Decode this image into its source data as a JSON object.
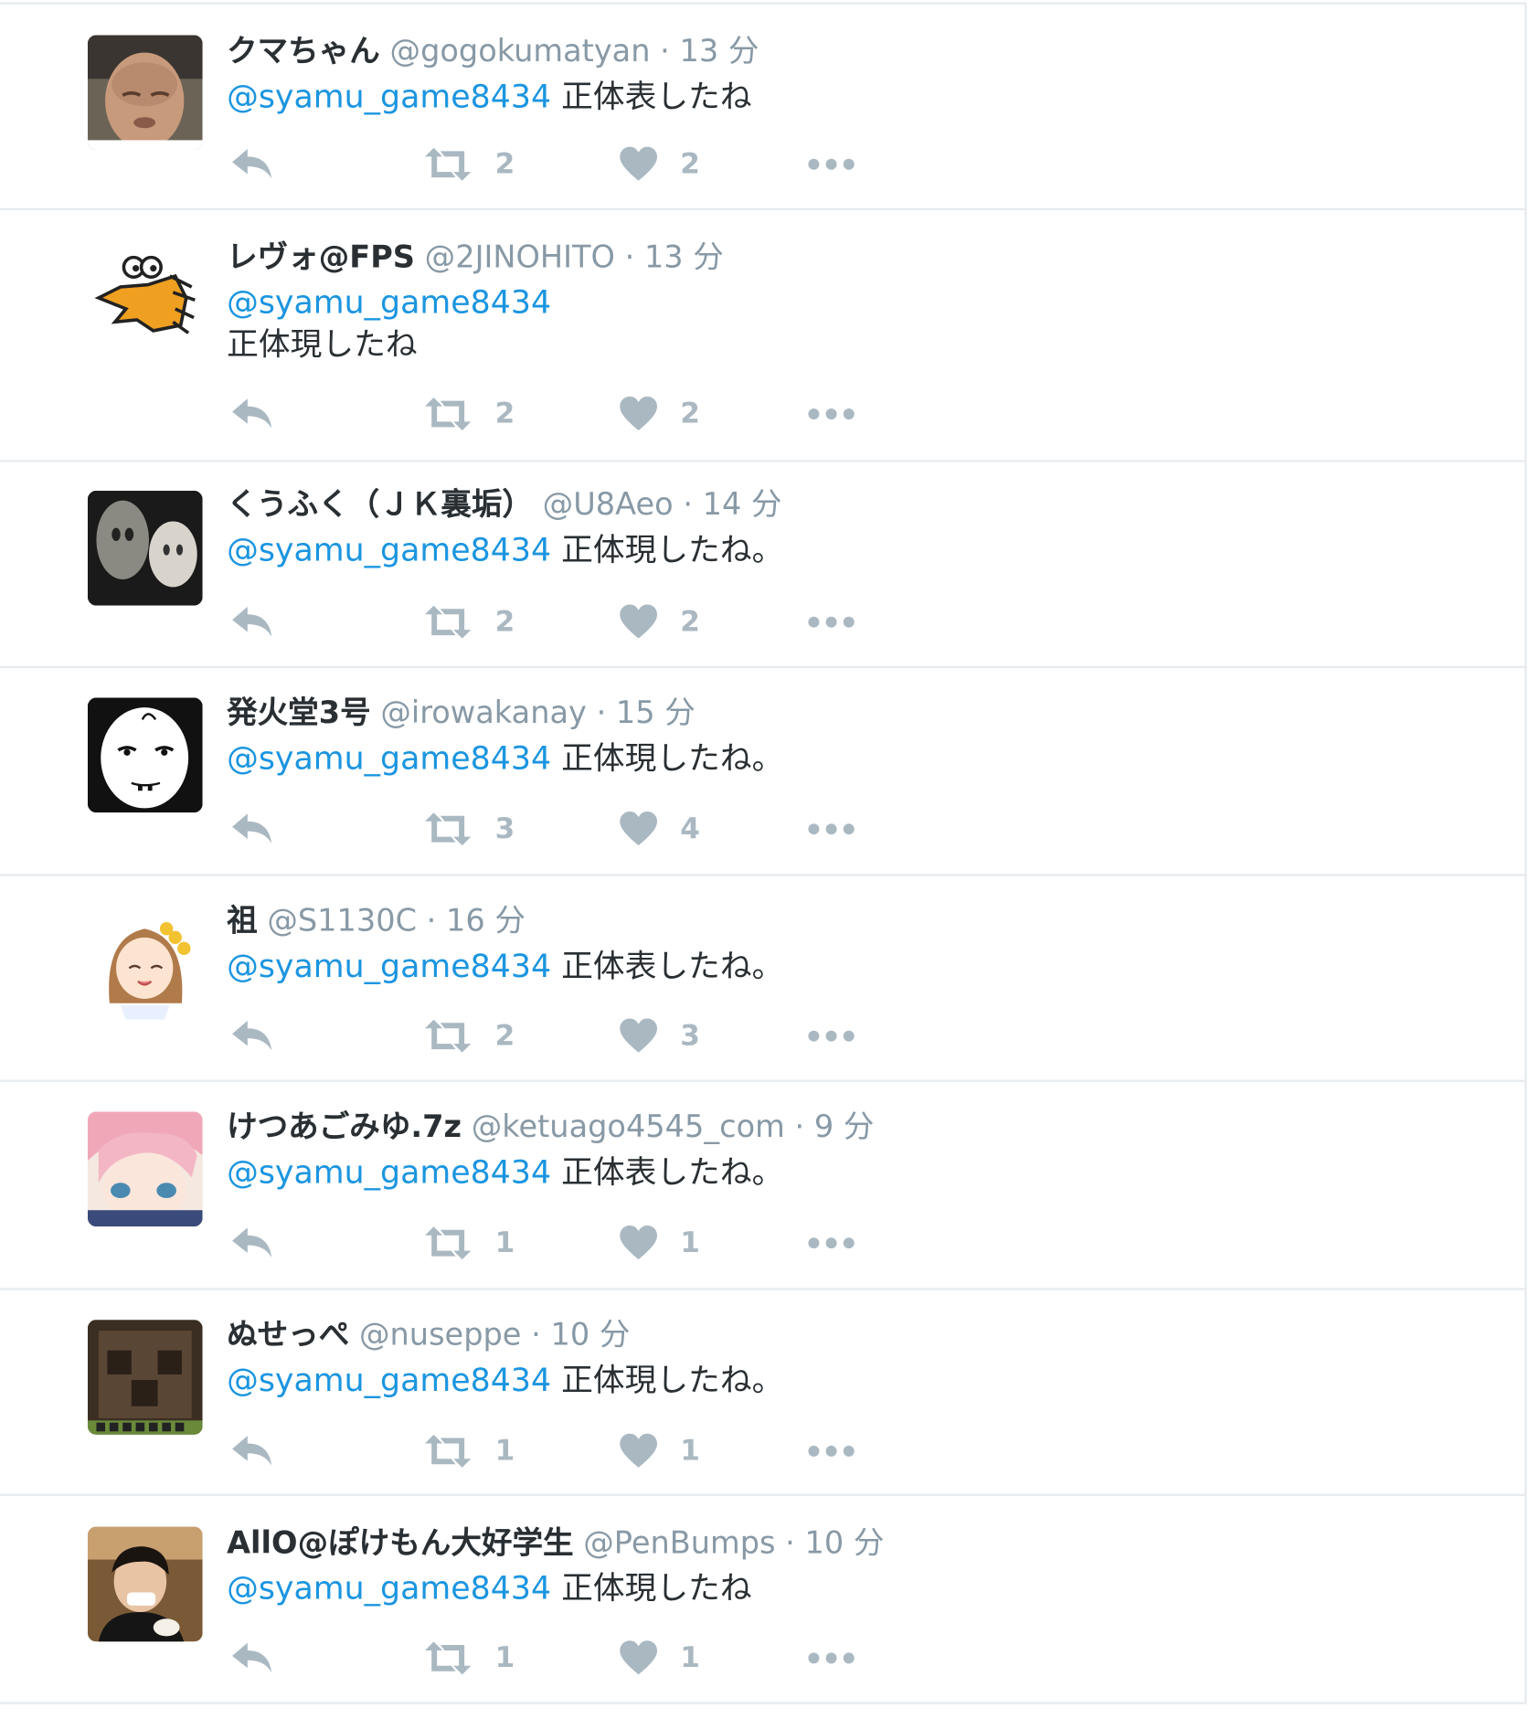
{
  "tweets": [
    {
      "name": "クマちゃん",
      "handle": "@gogokumatyan",
      "dot": "·",
      "time": "13 分",
      "mention": "@syamu_game8434",
      "text": " 正体表したね",
      "text2": "",
      "retweets": "2",
      "likes": "2",
      "avatar": "avatar-photo-man"
    },
    {
      "name": "レヴォ@FPS",
      "handle": "@2JINOHITO",
      "dot": "·",
      "time": "13 分",
      "mention": "@syamu_game8434",
      "text": "",
      "text2": "正体現したね",
      "retweets": "2",
      "likes": "2",
      "avatar": "avatar-cartoon-creature"
    },
    {
      "name": "くうふく（ＪＫ裏垢）",
      "handle": "@U8Aeo",
      "dot": "·",
      "time": "14 分",
      "mention": "@syamu_game8434",
      "text": " 正体現したね。",
      "text2": "",
      "retweets": "2",
      "likes": "2",
      "avatar": "avatar-masks"
    },
    {
      "name": "発火堂3号",
      "handle": "@irowakanay",
      "dot": "·",
      "time": "15 分",
      "mention": "@syamu_game8434",
      "text": " 正体現したね。",
      "text2": "",
      "retweets": "3",
      "likes": "4",
      "avatar": "avatar-drawn-face"
    },
    {
      "name": "祖",
      "handle": "@S1130C",
      "dot": "·",
      "time": "16 分",
      "mention": "@syamu_game8434",
      "text": " 正体表したね。",
      "text2": "",
      "retweets": "2",
      "likes": "3",
      "avatar": "avatar-anime-girl"
    },
    {
      "name": "けつあごみゆ.7z",
      "handle": "@ketuago4545_com",
      "dot": "·",
      "time": "9 分",
      "mention": "@syamu_game8434",
      "text": " 正体表したね。",
      "text2": "",
      "retweets": "1",
      "likes": "1",
      "avatar": "avatar-anime-pink-hair"
    },
    {
      "name": "ぬせっぺ",
      "handle": "@nuseppe",
      "dot": "·",
      "time": "10 分",
      "mention": "@syamu_game8434",
      "text": " 正体現したね。",
      "text2": "",
      "retweets": "1",
      "likes": "1",
      "avatar": "avatar-pixel-block"
    },
    {
      "name": "AllO@ぽけもん大好学生",
      "handle": "@PenBumps",
      "dot": "·",
      "time": "10 分",
      "mention": "@syamu_game8434",
      "text": " 正体現したね",
      "text2": "",
      "retweets": "1",
      "likes": "1",
      "avatar": "avatar-photo-person"
    }
  ],
  "colors": {
    "mention": "#1b95e0",
    "meta": "#8899a6",
    "icon": "#aab8c2",
    "text": "#292f33",
    "border": "#e6ecf0"
  }
}
